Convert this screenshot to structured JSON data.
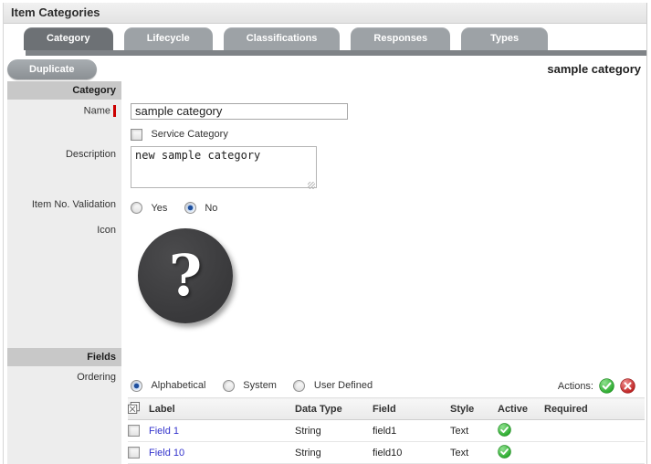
{
  "page": {
    "title": "Item Categories"
  },
  "tabs": [
    {
      "label": "Category",
      "active": true
    },
    {
      "label": "Lifecycle",
      "active": false
    },
    {
      "label": "Classifications",
      "active": false
    },
    {
      "label": "Responses",
      "active": false
    },
    {
      "label": "Types",
      "active": false
    }
  ],
  "toolbar": {
    "duplicate_label": "Duplicate",
    "context_title": "sample category"
  },
  "category_section": {
    "heading": "Category",
    "name_label": "Name",
    "name_value": "sample category",
    "service_category_label": "Service Category",
    "service_category_checked": false,
    "description_label": "Description",
    "description_value": "new sample category",
    "item_no_validation_label": "Item No. Validation",
    "item_no_options": [
      "Yes",
      "No"
    ],
    "item_no_selected": "No",
    "icon_label": "Icon",
    "icon_glyph": "?"
  },
  "fields_section": {
    "heading": "Fields",
    "ordering_label": "Ordering",
    "ordering_options": [
      "Alphabetical",
      "System",
      "User Defined"
    ],
    "ordering_selected": "Alphabetical",
    "actions_label": "Actions:",
    "actions_icons": [
      "confirm-icon",
      "cancel-icon"
    ],
    "table": {
      "headers": [
        "Label",
        "Data Type",
        "Field",
        "Style",
        "Active",
        "Required"
      ],
      "rows": [
        {
          "label": "Field 1",
          "data_type": "String",
          "field": "field1",
          "style": "Text",
          "active": true,
          "required": false
        },
        {
          "label": "Field 10",
          "data_type": "String",
          "field": "field10",
          "style": "Text",
          "active": true,
          "required": false
        }
      ]
    }
  },
  "colors": {
    "tab_active": "#6d7175",
    "tab_inactive": "#9da2a6",
    "section_bar": "#c8c8c8",
    "label_column": "#ededed",
    "link_blue": "#3333cc",
    "required_red": "#cc0000",
    "active_green": "#2aa62d",
    "cancel_red": "#c01818"
  }
}
